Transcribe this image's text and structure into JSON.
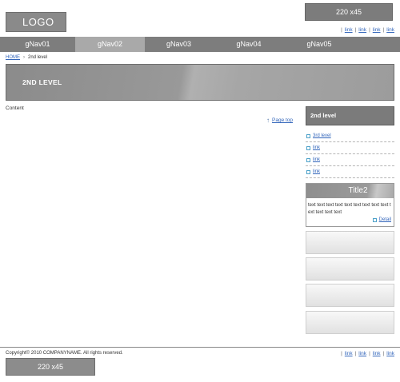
{
  "header": {
    "logo": "LOGO",
    "banner": "220 x45",
    "util_links": [
      "link",
      "link",
      "link",
      "link"
    ]
  },
  "gnav": {
    "items": [
      "gNav01",
      "gNav02",
      "gNav03",
      "gNav04",
      "gNav05"
    ],
    "active_index": 1
  },
  "breadcrumb": {
    "home": "HOME",
    "current": "2nd level"
  },
  "hero": {
    "title": "2ND LEVEL"
  },
  "main": {
    "content_label": "Content",
    "page_top": "Page top"
  },
  "sidebar": {
    "title": "2nd level",
    "items": [
      "3rd level",
      "link",
      "link",
      "link"
    ],
    "title2": {
      "heading": "Title2",
      "text": "text text text text text text text text text text text text text",
      "detail": "Detail"
    }
  },
  "footer": {
    "copyright": "Copyright© 2010 COMPANYNAME. All rights reserved.",
    "links": [
      "link",
      "link",
      "link",
      "link"
    ],
    "banner": "220 x45"
  },
  "colors": {
    "nav_bg": "#7d7d7d",
    "nav_active": "#a9a9a9",
    "link": "#3366bb",
    "bullet": "#4aa0c8"
  }
}
